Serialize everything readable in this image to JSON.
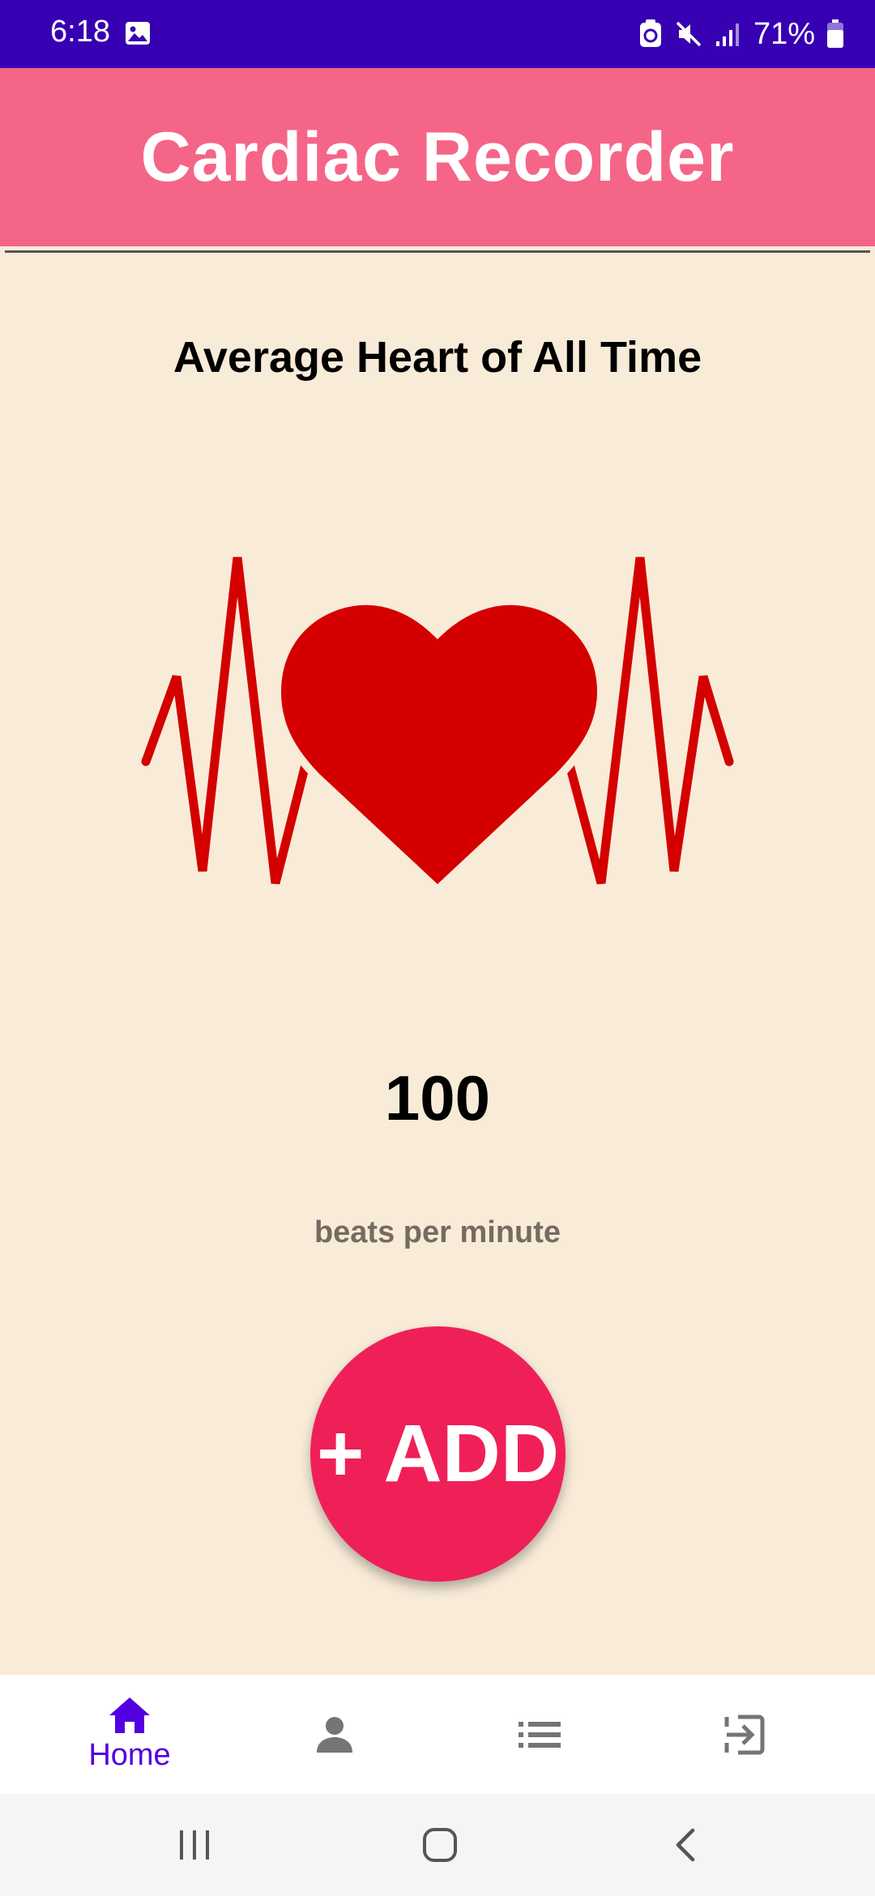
{
  "status_bar": {
    "time": "6:18",
    "battery": "71%",
    "icons": [
      "photo-icon",
      "data-saver-icon",
      "mute-icon",
      "signal-icon",
      "battery-icon"
    ]
  },
  "app_bar": {
    "title": "Cardiac Recorder"
  },
  "main": {
    "section_title": "Average Heart of All Time",
    "average_bpm": "100",
    "bpm_unit": "beats per minute",
    "add_button_label": "+ ADD"
  },
  "bottom_nav": {
    "items": [
      {
        "icon": "home-icon",
        "label": "Home",
        "active": true
      },
      {
        "icon": "person-icon",
        "label": "",
        "active": false
      },
      {
        "icon": "list-icon",
        "label": "",
        "active": false
      },
      {
        "icon": "logout-icon",
        "label": "",
        "active": false
      }
    ]
  },
  "system_nav": {
    "buttons": [
      "recents-button",
      "home-button",
      "back-button"
    ]
  },
  "colors": {
    "status_bar": "#3700b3",
    "app_bar": "#f56587",
    "background": "#f8ebd8",
    "heart": "#d40000",
    "add_button": "#ef2058",
    "nav_active": "#5200e0",
    "nav_inactive": "#757575"
  }
}
